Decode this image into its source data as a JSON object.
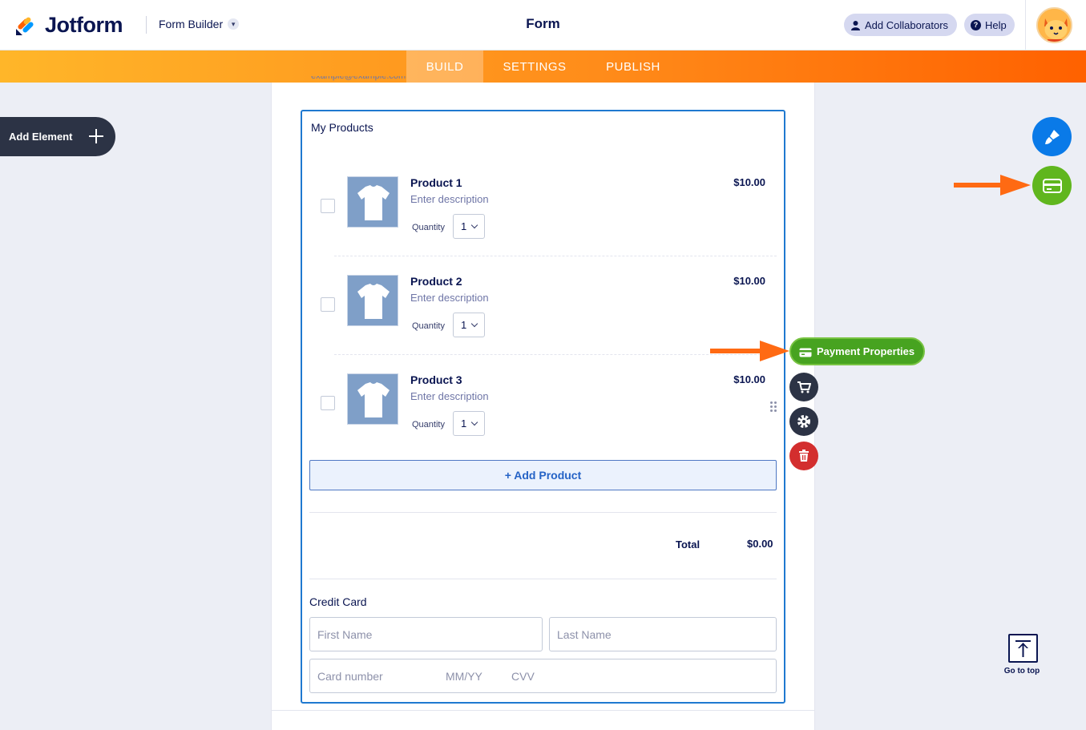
{
  "header": {
    "logo_text": "Jotform",
    "builder_menu": "Form Builder",
    "title": "Form",
    "add_collaborators": "Add Collaborators",
    "help": "Help"
  },
  "nav": {
    "tabs": [
      {
        "label": "BUILD",
        "active": true
      },
      {
        "label": "SETTINGS",
        "active": false
      },
      {
        "label": "PUBLISH",
        "active": false
      }
    ]
  },
  "left_panel": {
    "add_element": "Add Element"
  },
  "form": {
    "cut_off_text": "example@example.com",
    "widget_label": "My Products",
    "products": [
      {
        "name": "Product 1",
        "description": "Enter description",
        "quantity_label": "Quantity",
        "quantity": "1",
        "price": "$10.00"
      },
      {
        "name": "Product 2",
        "description": "Enter description",
        "quantity_label": "Quantity",
        "quantity": "1",
        "price": "$10.00"
      },
      {
        "name": "Product 3",
        "description": "Enter description",
        "quantity_label": "Quantity",
        "quantity": "1",
        "price": "$10.00"
      }
    ],
    "add_product": "+ Add Product",
    "total_label": "Total",
    "total_value": "$0.00",
    "credit_card_label": "Credit Card",
    "first_name_placeholder": "First Name",
    "last_name_placeholder": "Last Name",
    "card_number_placeholder": "Card number",
    "expiry_placeholder": "MM/YY",
    "cvv_placeholder": "CVV"
  },
  "toolbar": {
    "payment_properties": "Payment Properties",
    "icons": [
      "credit-card-icon",
      "cart-icon",
      "gear-icon",
      "trash-icon"
    ]
  },
  "right_panel": {
    "icons": [
      "paint-brush-icon",
      "credit-card-icon"
    ],
    "go_to_top": "Go to top"
  },
  "colors": {
    "brand_orange": "#ff6100",
    "accent_blue": "#0a7ae8",
    "payment_green": "#47a320",
    "delete_red": "#d32e2e",
    "arrow_orange": "#ff6a13"
  }
}
